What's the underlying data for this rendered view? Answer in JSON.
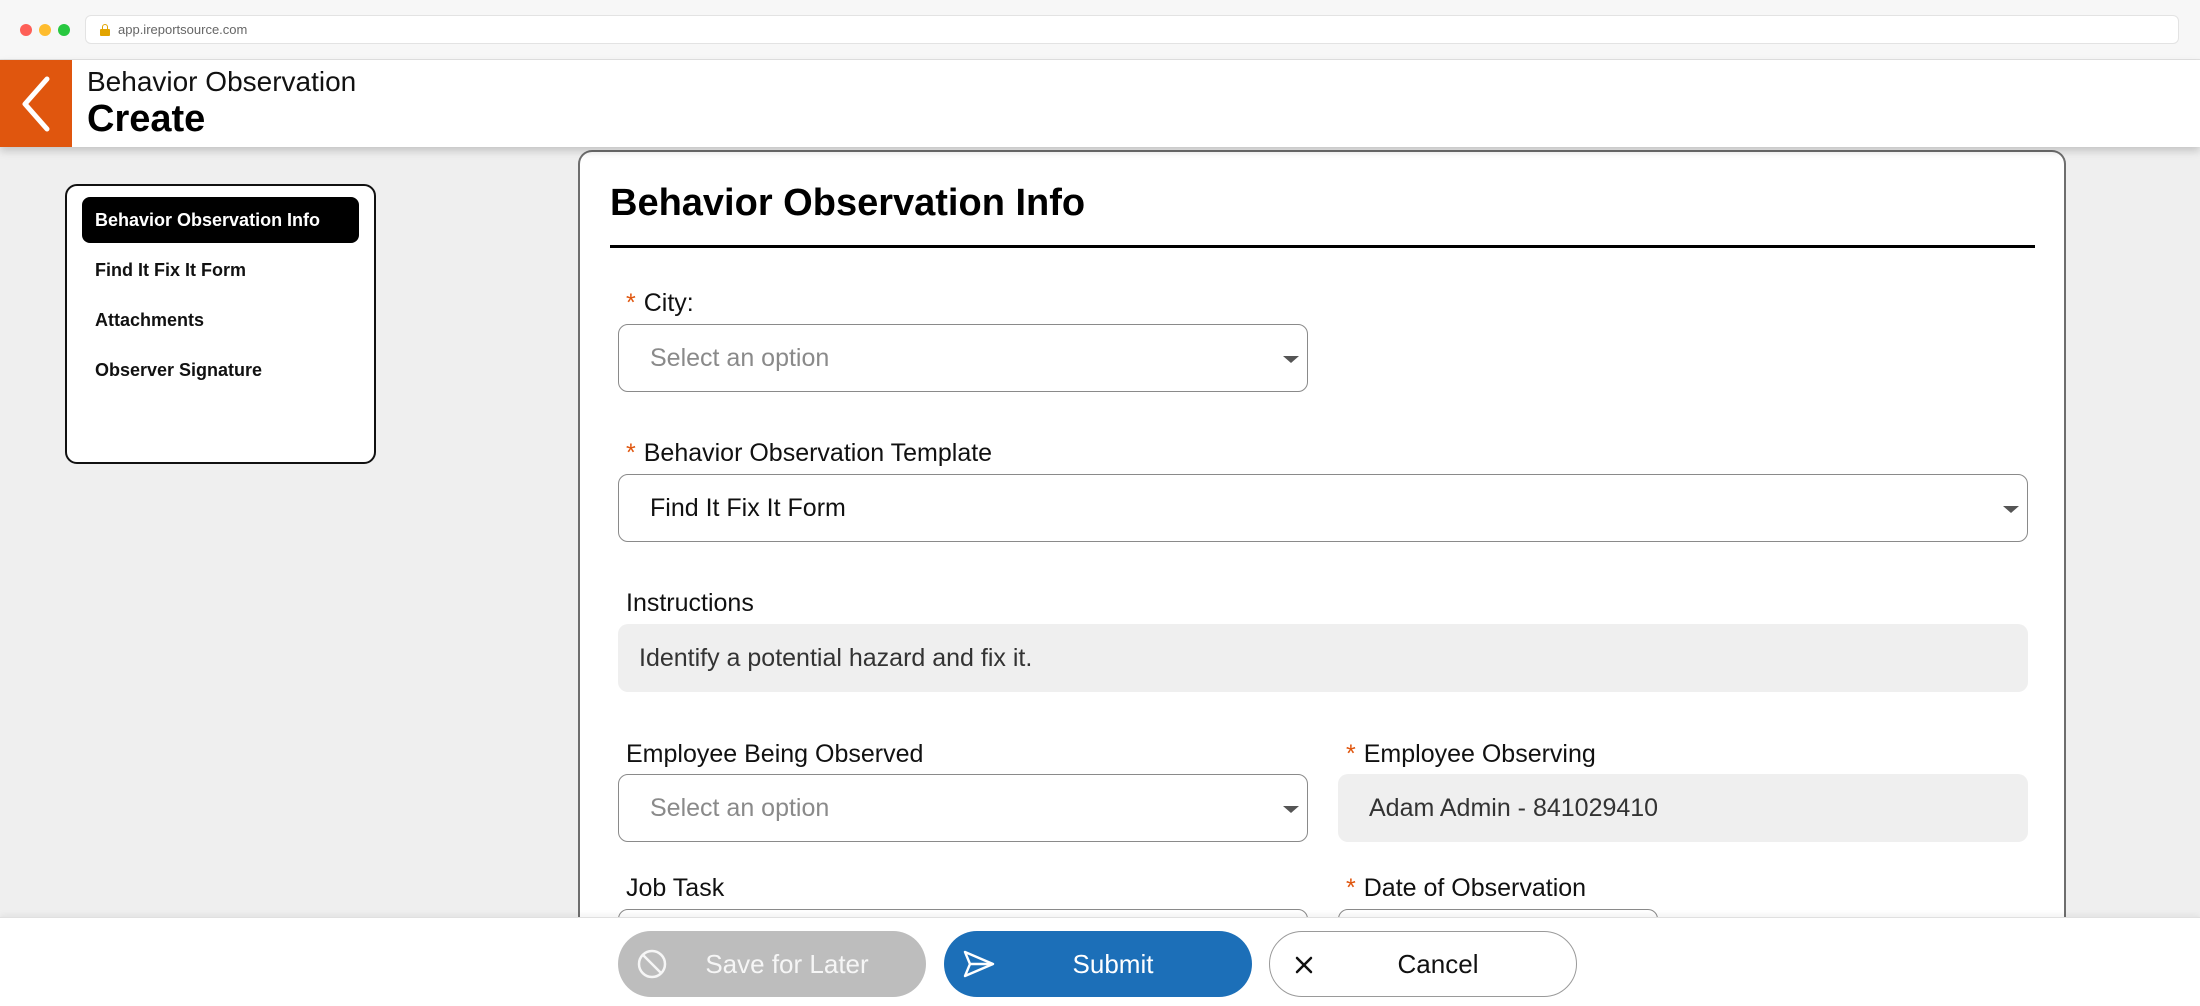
{
  "browser": {
    "url": "app.ireportsource.com"
  },
  "header": {
    "subtitle": "Behavior Observation",
    "title": "Create",
    "accent_color": "#e0560e"
  },
  "sidebar": {
    "items": [
      {
        "label": "Behavior Observation Info",
        "active": true
      },
      {
        "label": "Find It Fix It Form",
        "active": false
      },
      {
        "label": "Attachments",
        "active": false
      },
      {
        "label": "Observer Signature",
        "active": false
      }
    ]
  },
  "form": {
    "section_title": "Behavior Observation Info",
    "required_marker": "*",
    "city": {
      "label": "City:",
      "required": true,
      "placeholder": "Select an option"
    },
    "template": {
      "label": "Behavior Observation Template",
      "required": true,
      "value": "Find It Fix It Form"
    },
    "instructions": {
      "label": "Instructions",
      "value": "Identify a potential hazard and fix it."
    },
    "employee_observed": {
      "label": "Employee Being Observed",
      "required": false,
      "placeholder": "Select an option"
    },
    "employee_observing": {
      "label": "Employee Observing",
      "required": true,
      "value": "Adam Admin - 841029410"
    },
    "job_task": {
      "label": "Job Task",
      "required": false
    },
    "date_of_observation": {
      "label": "Date of Observation",
      "required": true
    }
  },
  "footer": {
    "save_label": "Save for Later",
    "submit_label": "Submit",
    "cancel_label": "Cancel",
    "submit_color": "#1c6fb8"
  }
}
